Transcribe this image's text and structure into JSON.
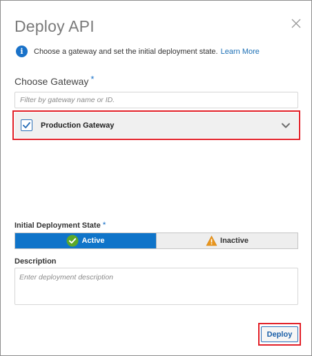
{
  "dialog": {
    "title": "Deploy API",
    "close_icon": "close-icon"
  },
  "info": {
    "icon": "info-icon",
    "text": "Choose a gateway and set the initial deployment state.",
    "link": "Learn More"
  },
  "gateway": {
    "label": "Choose Gateway",
    "required_mark": "*",
    "filter_placeholder": "Filter by gateway name or ID.",
    "filter_value": "",
    "selected": {
      "checked": true,
      "name": "Production Gateway"
    }
  },
  "deployment_state": {
    "label": "Initial Deployment State",
    "required_mark": "*",
    "options": [
      {
        "label": "Active",
        "icon": "check-circle-icon",
        "selected": true
      },
      {
        "label": "Inactive",
        "icon": "warning-icon",
        "selected": false
      }
    ]
  },
  "description": {
    "label": "Description",
    "placeholder": "Enter deployment description",
    "value": ""
  },
  "actions": {
    "deploy_label": "Deploy"
  },
  "colors": {
    "accent": "#0f74c9",
    "highlight": "#e21e26",
    "check_green": "#5ba829",
    "warning_orange": "#e8951d"
  }
}
